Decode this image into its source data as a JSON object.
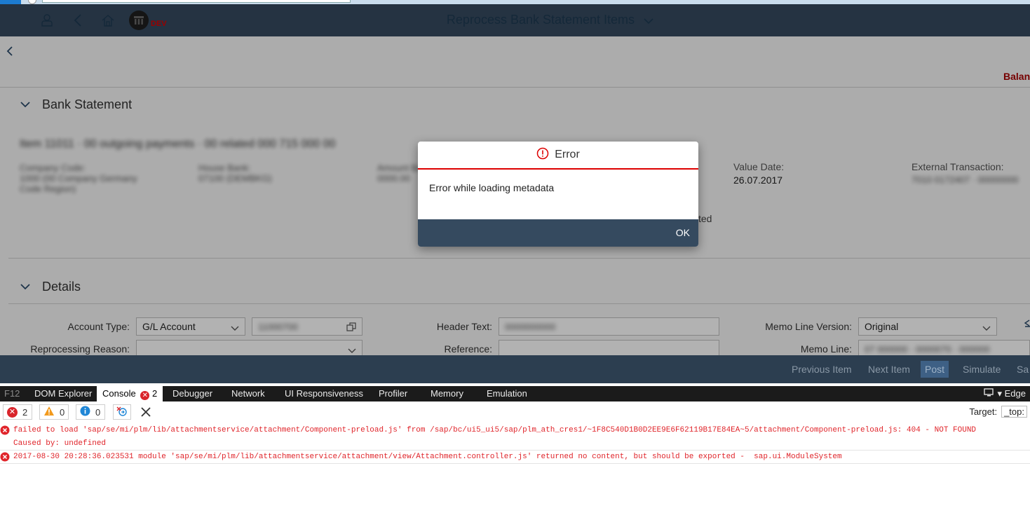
{
  "shell": {
    "title": "Reprocess Bank Statement Items",
    "env_badge": "DEV"
  },
  "page": {
    "balance_label": "Balan",
    "sections": {
      "bank_statement": "Bank Statement",
      "details": "Details"
    },
    "statement_fields": {
      "value_date_label": "Value Date:",
      "value_date": "26.07.2017",
      "external_transaction_label": "External Transaction:",
      "partial_status": "ted"
    },
    "details_fields": {
      "account_type_label": "Account Type:",
      "account_type_value": "G/L Account",
      "reprocessing_reason_label": "Reprocessing Reason:",
      "header_text_label": "Header Text:",
      "reference_label": "Reference:",
      "memo_line_version_label": "Memo Line Version:",
      "memo_line_version_value": "Original",
      "memo_line_label": "Memo Line:"
    }
  },
  "footer": {
    "previous": "Previous Item",
    "next": "Next Item",
    "post": "Post",
    "simulate": "Simulate",
    "save": "Sa"
  },
  "dialog": {
    "title": "Error",
    "message": "Error while loading metadata",
    "ok": "OK"
  },
  "devtools": {
    "tabs": {
      "f12": "F12",
      "dom": "DOM Explorer",
      "console": "Console",
      "console_count": "2",
      "debugger": "Debugger",
      "network": "Network",
      "ui": "UI Responsiveness",
      "profiler": "Profiler",
      "memory": "Memory",
      "emulation": "Emulation",
      "browser_mode": "Edge"
    },
    "toolbar": {
      "errors": "2",
      "warnings": "0",
      "info": "0",
      "target_label": "Target:",
      "target_value": "_top:"
    },
    "logs": [
      {
        "line1": "failed to load 'sap/se/mi/plm/lib/attachmentservice/attachment/Component-preload.js' from /sap/bc/ui5_ui5/sap/plm_ath_cres1/~1F8C540D1B0D2EE9E6F62119B17E84EA~5/attachment/Component-preload.js: 404 - NOT FOUND",
        "line2": "Caused by: undefined"
      },
      {
        "line1": "2017-08-30 20:28:36.023531 module 'sap/se/mi/plm/lib/attachmentservice/attachment/view/Attachment.controller.js' returned no content, but should be exported -  sap.ui.ModuleSystem"
      }
    ]
  },
  "colors": {
    "shell": "#354a5f",
    "error_red": "#d00000",
    "footer": "#2c3e50"
  }
}
